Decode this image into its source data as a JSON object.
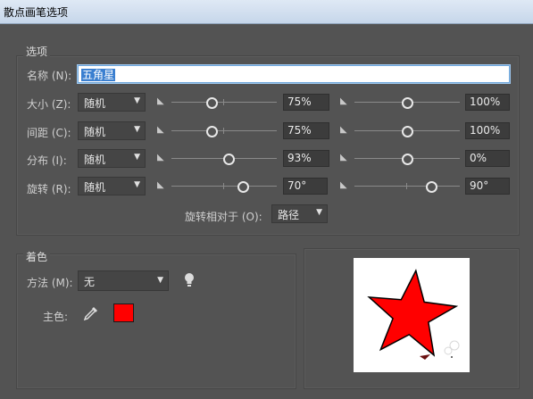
{
  "window": {
    "title": "散点画笔选项"
  },
  "options": {
    "group_title": "选项",
    "name_label": "名称 (N):",
    "name_value": "五角星",
    "rows": [
      {
        "label": "大小 (Z):",
        "mode": "随机",
        "min_value": "75%",
        "max_value": "100%"
      },
      {
        "label": "间距 (C):",
        "mode": "随机",
        "min_value": "75%",
        "max_value": "100%"
      },
      {
        "label": "分布 (I):",
        "mode": "随机",
        "min_value": "93%",
        "max_value": "0%"
      },
      {
        "label": "旋转 (R):",
        "mode": "随机",
        "min_value": "70°",
        "max_value": "90°"
      }
    ],
    "rotation_relative_label": "旋转相对于 (O):",
    "rotation_relative_value": "路径"
  },
  "colorization": {
    "group_title": "着色",
    "method_label": "方法 (M):",
    "method_value": "无",
    "key_color_label": "主色:",
    "key_color": "#ff0000"
  },
  "icons": {
    "lock": "pin-icon",
    "tips": "lightbulb-icon",
    "eyedropper": "eyedropper-icon",
    "dropdown": "chevron-down-icon"
  },
  "preview": {
    "star_fill": "#ff0000",
    "star_stroke": "#000000"
  }
}
